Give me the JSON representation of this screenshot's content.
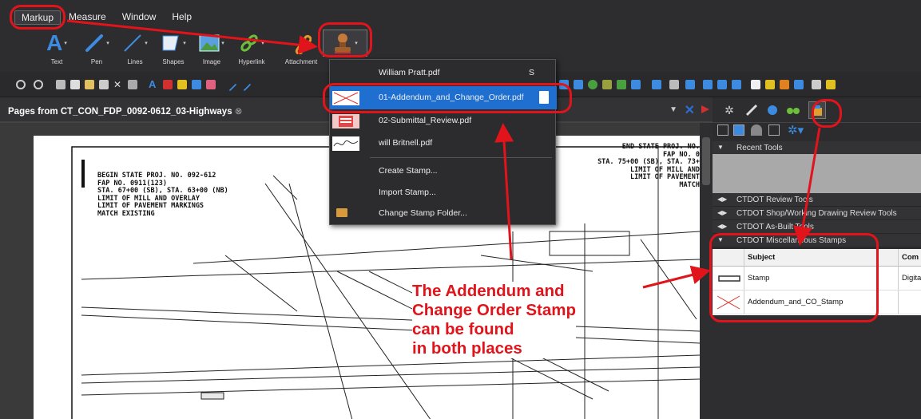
{
  "menubar": {
    "items": [
      "Markup",
      "Measure",
      "Window",
      "Help"
    ]
  },
  "ribbon": {
    "tools": [
      "Text",
      "Pen",
      "Lines",
      "Shapes",
      "Image",
      "Hyperlink",
      "Attachment"
    ]
  },
  "document": {
    "tab_title": "Pages from CT_CON_FDP_0092-0612_03-Highways",
    "tab_close_glyph": "⊗",
    "drawing_left": "BEGIN STATE PROJ. NO. 092-612\nFAP NO. 0911(123)\nSTA. 67+00 (SB), STA. 63+00 (NB)\nLIMIT OF MILL AND OVERLAY\nLIMIT OF PAVEMENT MARKINGS\nMATCH EXISTING",
    "drawing_right": "END STATE PROJ. NO.\nFAP NO. 0\nSTA. 75+00 (SB), STA. 73+\nLIMIT OF MILL AND\nLIMIT OF PAVEMENT\nMATCH"
  },
  "stamp_menu": {
    "items": [
      {
        "label": "William Pratt.pdf",
        "shortcut": "S"
      },
      {
        "label": "01-Addendum_and_Change_Order.pdf",
        "selected": true
      },
      {
        "label": "02-Submittal_Review.pdf"
      },
      {
        "label": "will Britnell.pdf"
      }
    ],
    "actions": [
      "Create Stamp...",
      "Import Stamp...",
      "Change Stamp Folder..."
    ]
  },
  "tool_chest": {
    "recent_tools": "Recent Tools",
    "sections": [
      "CTDOT Review Tools",
      "CTDOT Shop/Working Drawing Review Tools",
      "CTDOT As-Built Tools",
      "CTDOT Miscellaneous Stamps"
    ],
    "columns": [
      "Subject",
      "Com"
    ],
    "rows": [
      {
        "subject": "Stamp",
        "comment": "Digita"
      },
      {
        "subject": "Addendum_and_CO_Stamp",
        "comment": ""
      }
    ]
  },
  "annotation": {
    "lines": [
      "The Addendum and",
      "Change Order Stamp",
      "can be found",
      "in both places"
    ]
  },
  "colors": {
    "annotation_red": "#e0141a",
    "selection_blue": "#1f6fd0",
    "accent_blue": "#2a6fd2"
  }
}
